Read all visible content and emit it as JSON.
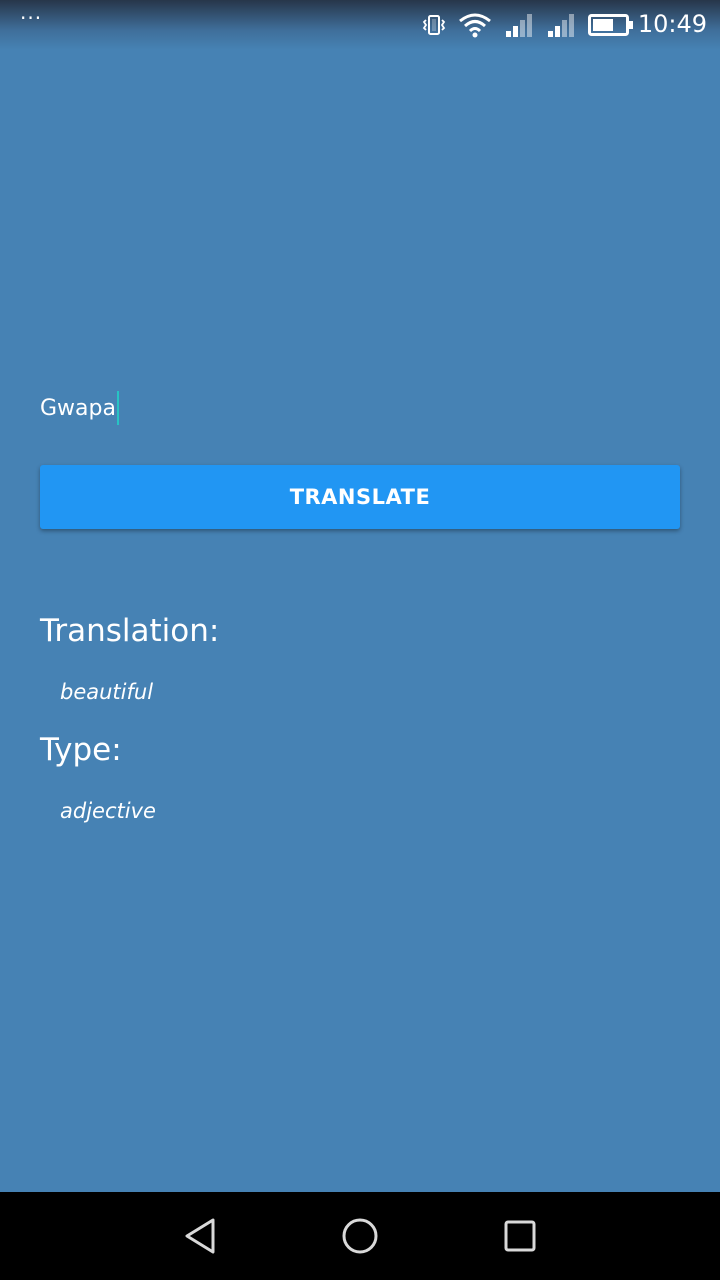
{
  "status_bar": {
    "overflow_dots": "···",
    "time": "10:49",
    "icons": [
      "vibrate-icon",
      "wifi-icon",
      "signal-icon",
      "signal-icon",
      "battery-icon"
    ]
  },
  "input": {
    "value": "Gwapa"
  },
  "translate_button": {
    "label": "TRANSLATE"
  },
  "result": {
    "translation_heading": "Translation:",
    "translation_value": "beautiful",
    "type_heading": "Type:",
    "type_value": "adjective"
  },
  "nav_bar": {
    "buttons": [
      "back",
      "home",
      "recents"
    ]
  },
  "colors": {
    "background": "#4682b4",
    "button": "#2196f3",
    "caret": "#27c4c4"
  }
}
